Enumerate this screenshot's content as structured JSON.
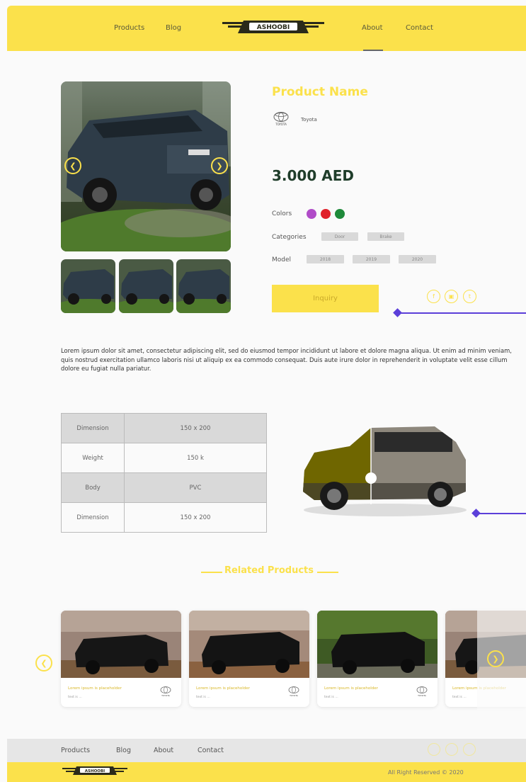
{
  "header": {
    "nav_left": [
      "Products",
      "Blog"
    ],
    "nav_right": [
      "About",
      "Contact"
    ],
    "active": "About",
    "logo_text": "ASHOOBI"
  },
  "product": {
    "name": "Product Name",
    "brand_name": "Toyota",
    "brand_logo_text": "TOYOTA",
    "price": "3.000 AED",
    "colors_label": "Colors",
    "colors": [
      "#b04cc8",
      "#e0202a",
      "#1f8a3a"
    ],
    "categories_label": "Categories",
    "categories": [
      "Door",
      "Brake"
    ],
    "model_label": "Model",
    "models": [
      "2018",
      "2019",
      "2020"
    ],
    "inquiry_label": "Inquiry",
    "social_icons": [
      "facebook-icon",
      "instagram-icon",
      "twitter-icon"
    ],
    "description": "Lorem ipsum dolor sit amet, consectetur adipiscing elit, sed do eiusmod tempor incididunt ut labore et dolore magna aliqua. Ut enim ad minim veniam, quis nostrud exercitation ullamco laboris nisi ut aliquip ex ea commodo consequat. Duis aute irure dolor in reprehenderit in voluptate velit esse cillum dolore eu fugiat nulla pariatur."
  },
  "specs": [
    {
      "key": "Dimension",
      "value": "150 x 200"
    },
    {
      "key": "Weight",
      "value": "150 k"
    },
    {
      "key": "Body",
      "value": "PVC"
    },
    {
      "key": "Dimension",
      "value": "150 x 200"
    }
  ],
  "related": {
    "title": "Related Products",
    "cards": [
      {
        "title": "Lorem ipsum is placeholder",
        "sub": "text is ...",
        "brand": "TOYOTA"
      },
      {
        "title": "Lorem ipsum is placeholder",
        "sub": "text is ...",
        "brand": "TOYOTA"
      },
      {
        "title": "Lorem ipsum is placeholder",
        "sub": "text is ...",
        "brand": "TOYOTA"
      },
      {
        "title": "Lorem ipsum is placeholder",
        "sub": "text is ...",
        "brand": ""
      }
    ]
  },
  "footer": {
    "links": [
      "Products",
      "Blog",
      "About",
      "Contact"
    ],
    "logo_text": "ASHOOBI",
    "copyright": "All Right Reserved © 2020"
  },
  "colors": {
    "accent": "#fbe14b",
    "price": "#1f3d2a",
    "decor": "#5b3fd9"
  }
}
